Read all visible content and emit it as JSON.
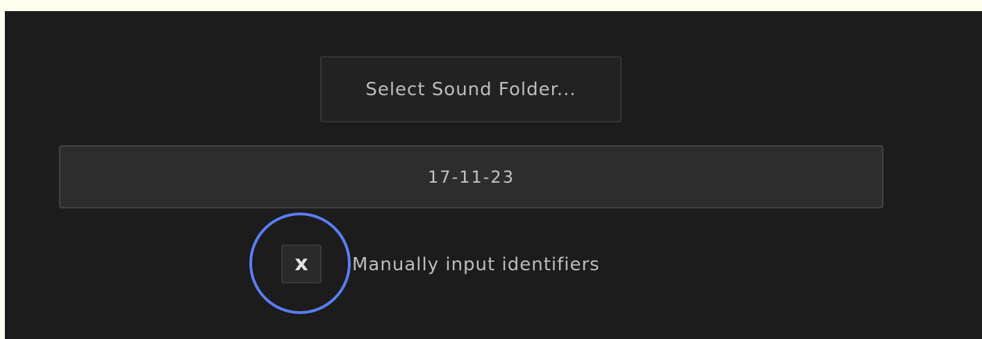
{
  "select_folder_button": {
    "label": "Select Sound Folder..."
  },
  "folder_field": {
    "value": "17-11-23"
  },
  "manual_identifiers": {
    "checked": true,
    "mark": "x",
    "label": "Manually input identifiers"
  },
  "colors": {
    "background": "#1c1c1c",
    "highlight_ring": "#5b7ef7"
  }
}
